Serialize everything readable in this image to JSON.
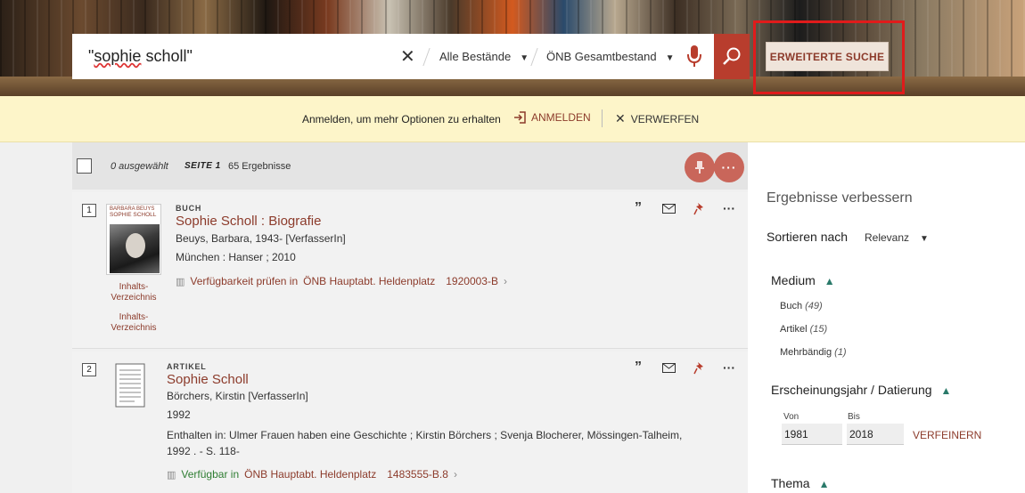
{
  "search": {
    "query": "\"sophie scholl\"",
    "scope": "Alle Bestände",
    "collection": "ÖNB Gesamtbestand",
    "advanced_label": "ERWEITERTE SUCHE"
  },
  "login_bar": {
    "text": "Anmelden, um mehr Optionen zu erhalten",
    "login_label": "ANMELDEN",
    "dismiss_label": "VERWERFEN"
  },
  "results_header": {
    "selected": "0 ausgewählt",
    "page": "SEITE 1",
    "count": "65 Ergebnisse"
  },
  "results": [
    {
      "index": "1",
      "type": "BUCH",
      "title": "Sophie Scholl : Biografie",
      "author": "Beuys, Barbara, 1943- [VerfasserIn]",
      "publisher": "München : Hanser ; 2010",
      "cover_author": "BARBARA BEUYS",
      "cover_title": "SOPHIE SCHOLL",
      "toc_1": "Inhalts-\nVerzeichnis",
      "toc_2": "Inhalts-\nVerzeichnis",
      "avail_text": "Verfügbarkeit prüfen in",
      "avail_location": "ÖNB Hauptabt. Heldenplatz",
      "avail_signature": "1920003-B"
    },
    {
      "index": "2",
      "type": "ARTIKEL",
      "title": "Sophie Scholl",
      "author": "Börchers, Kirstin [VerfasserIn]",
      "year": "1992",
      "contained_1": "Enthalten in: Ulmer Frauen haben eine Geschichte ; Kirstin Börchers ; Svenja Blocherer, Mössingen-Talheim,",
      "contained_2": "1992 . - S. 118-",
      "avail_text": "Verfügbar in",
      "avail_location": "ÖNB Hauptabt. Heldenplatz",
      "avail_signature": "1483555-B.8"
    }
  ],
  "sidebar": {
    "title": "Ergebnisse verbessern",
    "sort_label": "Sortieren nach",
    "sort_value": "Relevanz",
    "medium_heading": "Medium",
    "medium_items": [
      {
        "label": "Buch",
        "count": "(49)"
      },
      {
        "label": "Artikel",
        "count": "(15)"
      },
      {
        "label": "Mehrbändig",
        "count": "(1)"
      }
    ],
    "year_heading": "Erscheinungsjahr / Datierung",
    "from_label": "Von",
    "from_value": "1981",
    "to_label": "Bis",
    "to_value": "2018",
    "refine_label": "VERFEINERN",
    "topic_heading": "Thema"
  },
  "colors": {
    "accent": "#8c3b2b",
    "search_button": "#b83d2d",
    "highlight_outline": "#e01b1b",
    "login_bar_bg": "#fdf5c9",
    "available_green": "#2e7d32"
  }
}
